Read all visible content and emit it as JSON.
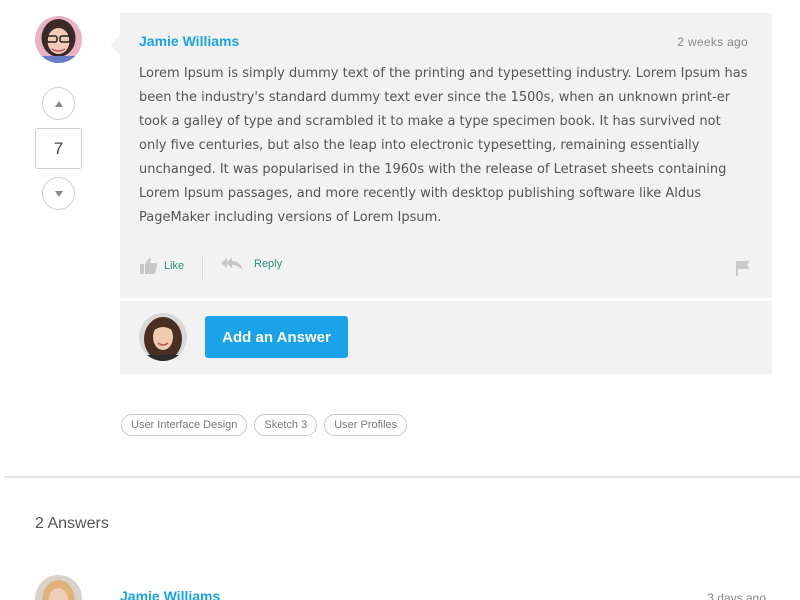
{
  "question": {
    "author": "Jamie Williams",
    "time": "2 weeks ago",
    "votes": "7",
    "body": "Lorem Ipsum is simply dummy text of the printing and typesetting industry. Lorem Ipsum has been the industry's standard dummy text ever since the 1500s, when an unknown print-er took a galley of type and scrambled it to make a type specimen book. It has survived not only five centuries, but also the leap into electronic typesetting, remaining essentially unchanged. It was popularised in the 1960s with the release of Letraset sheets containing Lorem Ipsum passages, and more recently with desktop publishing software like Aldus PageMaker including versions of Lorem Ipsum.",
    "like_label": "Like",
    "reply_label": "Reply"
  },
  "answer_box": {
    "button_label": "Add an Answer"
  },
  "tags": [
    "User Interface Design",
    "Sketch 3",
    "User Profiles"
  ],
  "answers": {
    "title": "2 Answers",
    "items": [
      {
        "author": "Jamie Williams",
        "time": "3 days ago"
      }
    ]
  },
  "colors": {
    "accent": "#1aa3e8",
    "action_text": "#2a8c7a",
    "card_bg": "#f2f2f2"
  },
  "icons": [
    "upvote-icon",
    "downvote-icon",
    "thumbs-up-icon",
    "reply-icon",
    "flag-icon"
  ]
}
